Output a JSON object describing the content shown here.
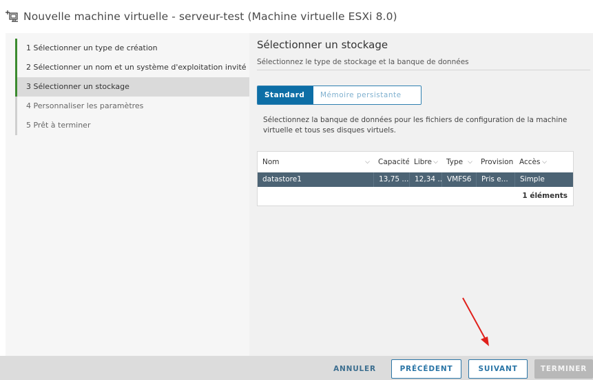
{
  "window": {
    "title": "Nouvelle machine virtuelle - serveur-test (Machine virtuelle ESXi 8.0)",
    "icon": "new-vm-icon"
  },
  "steps": [
    {
      "label": "1  Sélectionner un type de création",
      "state": "done"
    },
    {
      "label": "2  Sélectionner un nom et un système d'exploitation invité",
      "state": "done"
    },
    {
      "label": "3  Sélectionner un stockage",
      "state": "active"
    },
    {
      "label": "4  Personnaliser les paramètres",
      "state": "future"
    },
    {
      "label": "5  Prêt à terminer",
      "state": "future"
    }
  ],
  "main": {
    "title": "Sélectionner un stockage",
    "subtitle": "Sélectionnez le type de stockage et la banque de données",
    "tabs": [
      {
        "label": "Standard",
        "selected": true
      },
      {
        "label": "Mémoire persistante",
        "selected": false
      }
    ],
    "info": "Sélectionnez la banque de données pour les fichiers de configuration de la machine virtuelle et tous ses disques virtuels."
  },
  "grid": {
    "columns": [
      "Nom",
      "Capacité",
      "Libre",
      "Type",
      "Provision",
      "Accès"
    ],
    "rows": [
      [
        "datastore1",
        "13,75 ...",
        "12,34 ...",
        "VMFS6",
        "Pris e...",
        "Simple"
      ]
    ],
    "footer": "1 éléments"
  },
  "footer": {
    "cancel": "ANNULER",
    "previous": "PRÉCÉDENT",
    "next": "SUIVANT",
    "finish": "TERMINER"
  },
  "colors": {
    "accent": "#0d6ea6",
    "step_done": "#3b8a2f",
    "selected_row": "#4c6374",
    "annotation_arrow": "#e0201b"
  }
}
